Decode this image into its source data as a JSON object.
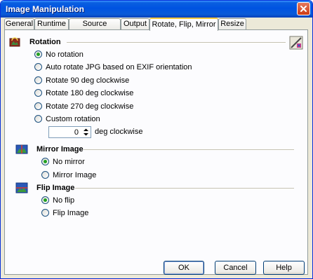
{
  "window": {
    "title": "Image Manipulation"
  },
  "tabs": [
    {
      "label": "General"
    },
    {
      "label": "Runtime"
    },
    {
      "label": "Source Images"
    },
    {
      "label": "Output"
    },
    {
      "label": "Rotate, Flip, Mirror",
      "active": true
    },
    {
      "label": "Resize"
    }
  ],
  "rotation": {
    "title": "Rotation",
    "options": [
      "No rotation",
      "Auto rotate JPG based on EXIF orientation",
      "Rotate 90 deg clockwise",
      "Rotate 180 deg clockwise",
      "Rotate 270 deg clockwise",
      "Custom rotation"
    ],
    "selected": "No rotation",
    "custom_value": "0",
    "custom_unit": "deg clockwise"
  },
  "mirror": {
    "title": "Mirror Image",
    "options": [
      "No mirror",
      "Mirror Image"
    ],
    "selected": "No mirror"
  },
  "flip": {
    "title": "Flip Image",
    "options": [
      "No flip",
      "Flip Image"
    ],
    "selected": "No flip"
  },
  "buttons": {
    "ok": "OK",
    "cancel": "Cancel",
    "help": "Help"
  },
  "colors": {
    "titlebar": "#0053e1",
    "active_tab_accent": "#ffc83c",
    "radio_dot": "#21a121"
  }
}
